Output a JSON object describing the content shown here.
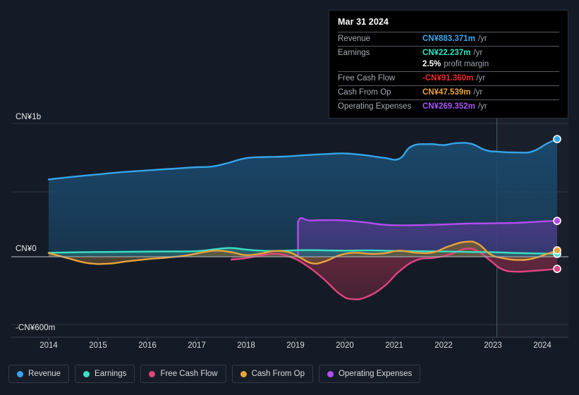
{
  "chart_data": {
    "type": "area",
    "title": "",
    "xlabel": "",
    "ylabel": "",
    "currency": "CN¥",
    "grid": true,
    "legend_position": "bottom",
    "xlim": [
      2013.7,
      2024.5
    ],
    "ylim": [
      -600,
      1000
    ],
    "x_ticks": [
      "2014",
      "2015",
      "2016",
      "2017",
      "2018",
      "2019",
      "2020",
      "2021",
      "2022",
      "2023",
      "2024"
    ],
    "y_ticks": [
      {
        "label": "CN¥1b",
        "value": 1000
      },
      {
        "label": "CN¥0",
        "value": 0
      },
      {
        "label": "-CN¥600m",
        "value": -600
      }
    ],
    "forecast_divider_year": 2023.08,
    "series": [
      {
        "name": "Revenue",
        "color": "#36a4ea",
        "fill": "#1b4a6e",
        "end_value": 883.371,
        "points": [
          [
            2014.0,
            580
          ],
          [
            2014.5,
            600
          ],
          [
            2015.0,
            618
          ],
          [
            2015.5,
            635
          ],
          [
            2016.0,
            648
          ],
          [
            2016.5,
            660
          ],
          [
            2017.0,
            672
          ],
          [
            2017.3,
            676
          ],
          [
            2017.6,
            700
          ],
          [
            2018.0,
            740
          ],
          [
            2018.4,
            748
          ],
          [
            2018.8,
            752
          ],
          [
            2019.2,
            762
          ],
          [
            2019.6,
            770
          ],
          [
            2020.0,
            775
          ],
          [
            2020.4,
            762
          ],
          [
            2020.8,
            742
          ],
          [
            2021.1,
            735
          ],
          [
            2021.35,
            828
          ],
          [
            2021.7,
            845
          ],
          [
            2022.0,
            838
          ],
          [
            2022.25,
            852
          ],
          [
            2022.55,
            848
          ],
          [
            2022.85,
            800
          ],
          [
            2023.1,
            788
          ],
          [
            2023.5,
            782
          ],
          [
            2023.8,
            790
          ],
          [
            2024.1,
            850
          ],
          [
            2024.3,
            883
          ]
        ]
      },
      {
        "name": "Operating Expenses",
        "color": "#b34cf0",
        "fill": "#4a3a85",
        "end_value": 269.352,
        "start_year": 2019.05,
        "points": [
          [
            2019.05,
            0
          ],
          [
            2019.05,
            262
          ],
          [
            2019.3,
            272
          ],
          [
            2019.7,
            275
          ],
          [
            2020.0,
            272
          ],
          [
            2020.4,
            258
          ],
          [
            2020.8,
            240
          ],
          [
            2021.2,
            236
          ],
          [
            2021.6,
            238
          ],
          [
            2022.0,
            242
          ],
          [
            2022.4,
            248
          ],
          [
            2022.8,
            250
          ],
          [
            2023.2,
            252
          ],
          [
            2023.6,
            256
          ],
          [
            2024.0,
            265
          ],
          [
            2024.3,
            269
          ]
        ]
      },
      {
        "name": "Earnings",
        "color": "#3ae0c4",
        "fill": "#2e6f72",
        "end_value": 22.237,
        "points": [
          [
            2014.0,
            30
          ],
          [
            2014.6,
            34
          ],
          [
            2015.2,
            36
          ],
          [
            2015.8,
            38
          ],
          [
            2016.4,
            40
          ],
          [
            2017.0,
            42
          ],
          [
            2017.4,
            58
          ],
          [
            2017.7,
            66
          ],
          [
            2018.0,
            54
          ],
          [
            2018.4,
            44
          ],
          [
            2018.8,
            46
          ],
          [
            2019.2,
            50
          ],
          [
            2019.6,
            48
          ],
          [
            2020.0,
            46
          ],
          [
            2020.5,
            48
          ],
          [
            2021.0,
            44
          ],
          [
            2021.5,
            42
          ],
          [
            2022.0,
            40
          ],
          [
            2022.5,
            36
          ],
          [
            2023.0,
            34
          ],
          [
            2023.5,
            28
          ],
          [
            2024.0,
            24
          ],
          [
            2024.3,
            22
          ]
        ]
      },
      {
        "name": "Cash From Op",
        "color": "#e8a33d",
        "fill": "#6e5a38",
        "end_value": 47.539,
        "points": [
          [
            2014.0,
            28
          ],
          [
            2014.4,
            -12
          ],
          [
            2014.8,
            -48
          ],
          [
            2015.2,
            -52
          ],
          [
            2015.6,
            -34
          ],
          [
            2016.0,
            -18
          ],
          [
            2016.4,
            -6
          ],
          [
            2016.8,
            10
          ],
          [
            2017.1,
            32
          ],
          [
            2017.4,
            46
          ],
          [
            2017.7,
            34
          ],
          [
            2018.0,
            12
          ],
          [
            2018.3,
            24
          ],
          [
            2018.6,
            44
          ],
          [
            2018.9,
            30
          ],
          [
            2019.1,
            -8
          ],
          [
            2019.35,
            -50
          ],
          [
            2019.6,
            -34
          ],
          [
            2019.9,
            12
          ],
          [
            2020.2,
            30
          ],
          [
            2020.5,
            22
          ],
          [
            2020.8,
            26
          ],
          [
            2021.1,
            46
          ],
          [
            2021.45,
            30
          ],
          [
            2021.8,
            34
          ],
          [
            2022.1,
            78
          ],
          [
            2022.45,
            112
          ],
          [
            2022.7,
            96
          ],
          [
            2022.95,
            18
          ],
          [
            2023.2,
            -10
          ],
          [
            2023.5,
            -24
          ],
          [
            2023.8,
            -14
          ],
          [
            2024.1,
            22
          ],
          [
            2024.3,
            48
          ]
        ]
      },
      {
        "name": "Free Cash Flow",
        "color": "#e0457f",
        "fill": "#6b2840",
        "end_value": -91.36,
        "start_year": 2017.7,
        "points": [
          [
            2017.7,
            -22
          ],
          [
            2018.0,
            -10
          ],
          [
            2018.3,
            10
          ],
          [
            2018.6,
            22
          ],
          [
            2018.9,
            -2
          ],
          [
            2019.2,
            -60
          ],
          [
            2019.55,
            -160
          ],
          [
            2019.9,
            -280
          ],
          [
            2020.15,
            -318
          ],
          [
            2020.45,
            -300
          ],
          [
            2020.8,
            -220
          ],
          [
            2021.1,
            -110
          ],
          [
            2021.45,
            -26
          ],
          [
            2021.8,
            -8
          ],
          [
            2022.1,
            14
          ],
          [
            2022.45,
            60
          ],
          [
            2022.7,
            40
          ],
          [
            2022.95,
            -30
          ],
          [
            2023.2,
            -96
          ],
          [
            2023.5,
            -112
          ],
          [
            2023.8,
            -106
          ],
          [
            2024.1,
            -98
          ],
          [
            2024.3,
            -91
          ]
        ]
      }
    ]
  },
  "tooltip": {
    "date": "Mar 31 2024",
    "rows": [
      {
        "label": "Revenue",
        "value": "CN¥883.371m",
        "suffix": "/yr",
        "color": "#3ba9f0"
      },
      {
        "label": "Earnings",
        "value": "CN¥22.237m",
        "suffix": "/yr",
        "color": "#2ee6c5"
      },
      {
        "label": "",
        "value": "2.5%",
        "suffix": "profit margin",
        "color": "#ffffff"
      },
      {
        "label": "Free Cash Flow",
        "value": "-CN¥91.360m",
        "suffix": "/yr",
        "color": "#f0292e"
      },
      {
        "label": "Cash From Op",
        "value": "CN¥47.539m",
        "suffix": "/yr",
        "color": "#e8a33d"
      },
      {
        "label": "Operating Expenses",
        "value": "CN¥269.352m",
        "suffix": "/yr",
        "color": "#a855f7"
      }
    ]
  },
  "legend": {
    "items": [
      {
        "label": "Revenue",
        "color": "#36a4ea"
      },
      {
        "label": "Earnings",
        "color": "#3ae0c4"
      },
      {
        "label": "Free Cash Flow",
        "color": "#e0457f"
      },
      {
        "label": "Cash From Op",
        "color": "#e8a33d"
      },
      {
        "label": "Operating Expenses",
        "color": "#b34cf0"
      }
    ]
  }
}
